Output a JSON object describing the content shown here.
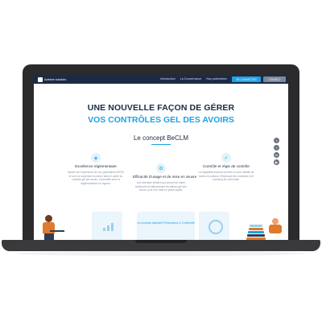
{
  "logo": {
    "text": "Actimize solutions"
  },
  "nav": {
    "items": [
      "Introduction",
      "La Gouvernance",
      "Nos partenaires"
    ],
    "connect_label": "SE CONNECTER",
    "contact_label": "CONTACT"
  },
  "hero": {
    "line1": "UNE NOUVELLE FAÇON DE GÉRER",
    "line2": "VOS CONTRÔLES GEL DES AVOIRS"
  },
  "concept": {
    "title": "Le concept BeCLM"
  },
  "social": {
    "icons": [
      "twitter-icon",
      "facebook-icon",
      "linkedin-icon",
      "youtube-icon"
    ]
  },
  "features": [
    {
      "title": "Excellence réglementaire",
      "text": "Basée sur l'expérience de nos partenaires AYRIS et sur une expertise reconnue dans le cadre du contrôle gel des avoirs, conformité avec la réglementation en vigueur."
    },
    {
      "title": "Efficacité d'usage et de mise en œuvre",
      "text": "Une interface intuitive qui permet de traiter facilement et efficacement les alertes gel des avoirs, pour une mise en place rapide."
    },
    {
      "title": "Contrôle et régie de contrôle",
      "text": "La traçabilité avancée permet un suivi détaillé de toutes les actions, l'historique des contrôles et le reporting de conformité."
    }
  ],
  "cards": [
    {
      "label": ""
    },
    {
      "label": "Un nouveau standard Performance & Conformité"
    },
    {
      "label": ""
    }
  ],
  "colors": {
    "navy": "#1b2b47",
    "accent": "#1aa3e8",
    "grey": "#7d8797"
  }
}
